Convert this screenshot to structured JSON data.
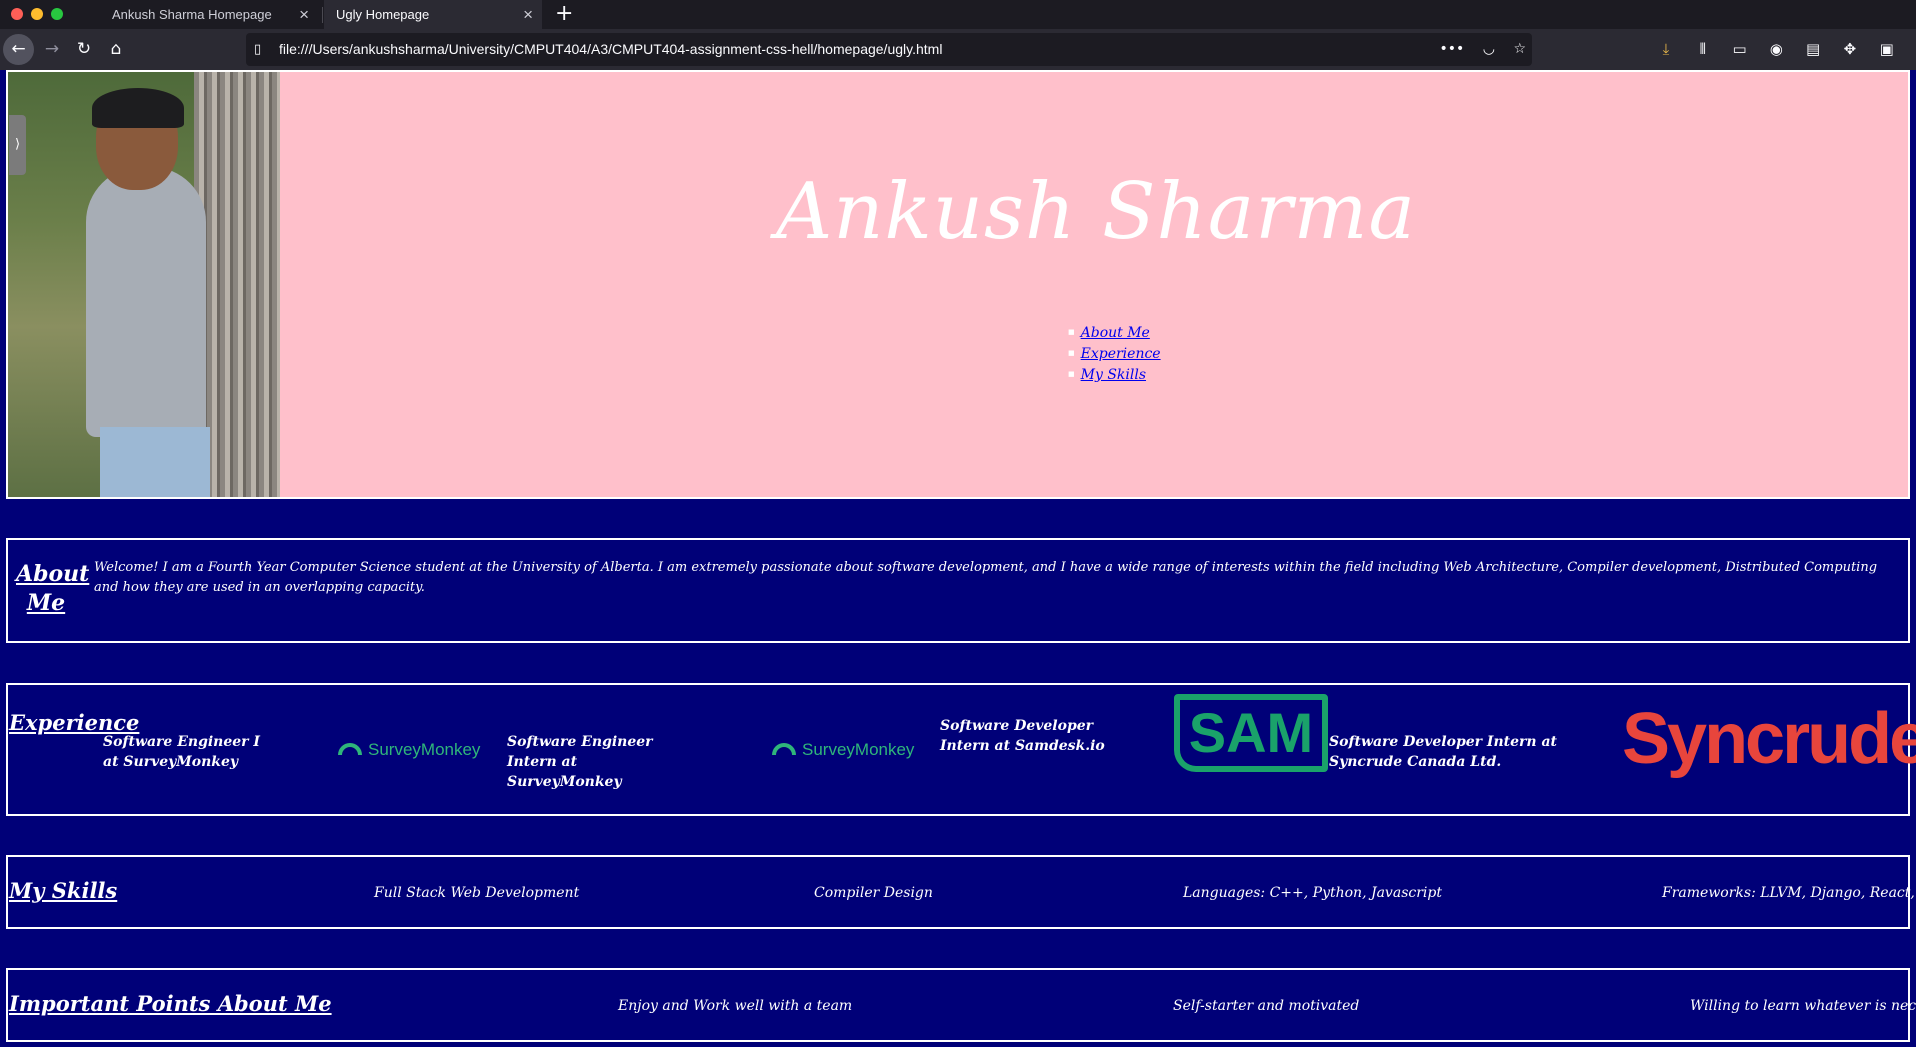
{
  "browser": {
    "tabs": [
      {
        "label": "Ankush Sharma Homepage",
        "active": false
      },
      {
        "label": "Ugly Homepage",
        "active": true
      }
    ],
    "url": "file:///Users/ankushsharma/University/CMPUT404/A3/CMPUT404-assignment-css-hell/homepage/ugly.html",
    "new_tab_icon": "plus-icon",
    "close_icon": "close-icon"
  },
  "header": {
    "name": "Ankush Sharma",
    "nav": [
      "About Me",
      "Experience",
      "My Skills"
    ],
    "background": "#ffc0cb"
  },
  "about": {
    "title": "About Me",
    "text": "Welcome! I am a Fourth Year Computer Science student at the University of Alberta. I am extremely passionate about software development, and I have a wide range of interests within the field including Web Architecture, Compiler development, Distributed Computing and how they are used in an overlapping capacity."
  },
  "experience": {
    "title": "Experience",
    "items": [
      "Software Engineer I at SurveyMonkey",
      "Software Engineer Intern at SurveyMonkey",
      "Software Developer Intern at Samdesk.io",
      "Software Developer Intern at Syncrude Canada Ltd."
    ],
    "logos": [
      "SurveyMonkey",
      "SurveyMonkey",
      "SAM",
      "Syncrude"
    ]
  },
  "skills": {
    "title": "My Skills",
    "items": [
      "Full Stack Web Development",
      "Compiler Design",
      "Languages: C++, Python, Javascript",
      "Frameworks: LLVM, Django, React, Vue.js"
    ]
  },
  "points": {
    "title": "Important Points About Me",
    "items": [
      "Enjoy and Work well with a team",
      "Self-starter and motivated",
      "Willing to learn whatever is necessary"
    ]
  },
  "colors": {
    "page_background": "#000078",
    "text": "#ffffff",
    "surveymonkey_green": "#2fb57a",
    "sam_green": "#1aa26a",
    "syncrude_red": "#e8453c"
  }
}
